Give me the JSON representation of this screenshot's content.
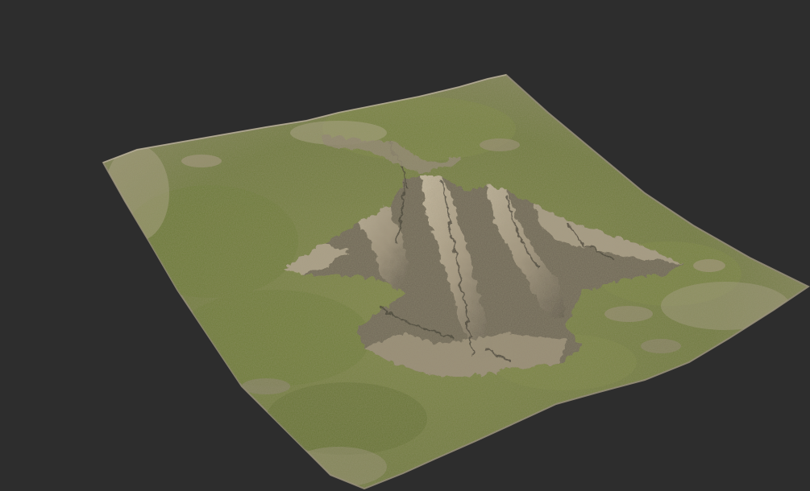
{
  "scene": {
    "subject": "3d-terrain-heightmap-render",
    "colors": {
      "background": "#2d2d2d",
      "grass": "#6f7a3e",
      "grass_light": "#8a9150",
      "grass_dark": "#4f5a2a",
      "rock": "#a89a84",
      "rock_light": "#c9bca4",
      "rock_shadow": "#3e3a33",
      "edge": "#7d7460"
    }
  }
}
